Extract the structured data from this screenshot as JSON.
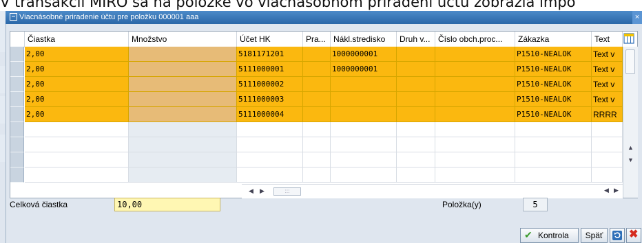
{
  "background": {
    "line_text": "V transakcii MIRO sa na položke vo viacnásobnom priradení účtu zobrazia impo"
  },
  "dialog": {
    "title": "Viacnásobné priradenie účtu pre položku 000001 aaa",
    "close_symbol": "×"
  },
  "table": {
    "columns": [
      "Čiastka",
      "Množstvo",
      "Účet HK",
      "Pra...",
      "Nákl.stredisko",
      "Druh v...",
      "Číslo obch.proc...",
      "Zákazka",
      "Text"
    ],
    "rows": [
      {
        "amount": "2,00",
        "quantity": "",
        "gl_account": "5181171201",
        "pra": "",
        "cost_center": "1000000001",
        "druh": "",
        "obch_proc": "",
        "order": "P1510-NEALOK",
        "text": "Text v"
      },
      {
        "amount": "2,00",
        "quantity": "",
        "gl_account": "5111000001",
        "pra": "",
        "cost_center": "1000000001",
        "druh": "",
        "obch_proc": "",
        "order": "P1510-NEALOK",
        "text": "Text v"
      },
      {
        "amount": "2,00",
        "quantity": "",
        "gl_account": "5111000002",
        "pra": "",
        "cost_center": "",
        "druh": "",
        "obch_proc": "",
        "order": "P1510-NEALOK",
        "text": "Text v"
      },
      {
        "amount": "2,00",
        "quantity": "",
        "gl_account": "5111000003",
        "pra": "",
        "cost_center": "",
        "druh": "",
        "obch_proc": "",
        "order": "P1510-NEALOK",
        "text": "Text v"
      },
      {
        "amount": "2,00",
        "quantity": "",
        "gl_account": "5111000004",
        "pra": "",
        "cost_center": "",
        "druh": "",
        "obch_proc": "",
        "order": "P1510-NEALOK",
        "text": "RRRR"
      }
    ],
    "row_color": "#fbb80f",
    "qty_color": "#e7bb77"
  },
  "footer": {
    "total_label": "Celková čiastka",
    "total_value": "10,00",
    "items_label": "Položka(y)",
    "items_value": "5"
  },
  "buttons": {
    "check_label": "Kontrola",
    "back_label": "Späť"
  }
}
